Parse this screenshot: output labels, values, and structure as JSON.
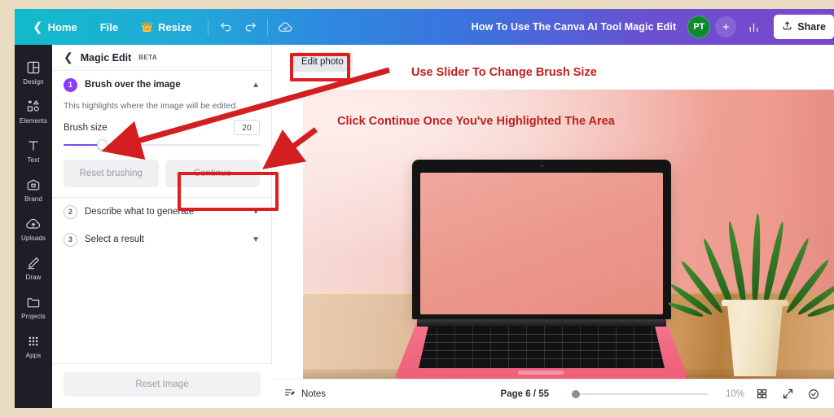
{
  "topbar": {
    "back_icon": "chevron-left-icon",
    "home_label": "Home",
    "file_label": "File",
    "resize_label": "Resize",
    "resize_icon": "crown-icon",
    "undo_icon": "undo-icon",
    "redo_icon": "redo-icon",
    "cloud_icon": "cloud-saved-icon",
    "doc_title": "How To Use The Canva AI Tool Magic Edit",
    "avatar_initials": "PT",
    "avatar_color": "#0d8a2e",
    "add_member_label": "+",
    "insights_icon": "bar-chart-icon",
    "share_label": "Share",
    "share_icon": "upload-icon"
  },
  "rail": {
    "items": [
      {
        "label": "Design",
        "icon": "design-icon"
      },
      {
        "label": "Elements",
        "icon": "shapes-icon"
      },
      {
        "label": "Text",
        "icon": "text-icon"
      },
      {
        "label": "Brand",
        "icon": "brand-icon"
      },
      {
        "label": "Uploads",
        "icon": "upload-cloud-icon"
      },
      {
        "label": "Draw",
        "icon": "pen-icon"
      },
      {
        "label": "Projects",
        "icon": "folder-icon"
      },
      {
        "label": "Apps",
        "icon": "grid-apps-icon"
      }
    ]
  },
  "panel": {
    "back_icon": "chevron-left-icon",
    "title": "Magic Edit",
    "beta": "BETA",
    "steps": [
      {
        "num": "1",
        "label": "Brush over the image",
        "caret": "chevron-up-icon"
      },
      {
        "num": "2",
        "label": "Describe what to generate",
        "caret": "chevron-down-icon"
      },
      {
        "num": "3",
        "label": "Select a result",
        "caret": "chevron-down-icon"
      }
    ],
    "description": "This highlights where the image will be edited.",
    "brush_size_label": "Brush size",
    "brush_size_value": "20",
    "reset_brushing_label": "Reset brushing",
    "continue_label": "Continue",
    "reset_image_label": "Reset Image",
    "accent_color": "#8b3dff"
  },
  "canvas": {
    "edit_photo_label": "Edit photo",
    "collapse_icon": "chevron-up-icon"
  },
  "bottombar": {
    "notes_icon": "notes-icon",
    "notes_label": "Notes",
    "page_label": "Page 6 / 55",
    "zoom_percent": "10%",
    "grid_icon": "grid-view-icon",
    "expand_icon": "fullscreen-icon",
    "help_icon": "check-circle-icon"
  },
  "annotations": {
    "slider_text": "Use Slider To Change Brush Size",
    "continue_text": "Click Continue Once You've Highlighted The Area",
    "color": "#c0201e",
    "box_color": "#e01c1c"
  }
}
